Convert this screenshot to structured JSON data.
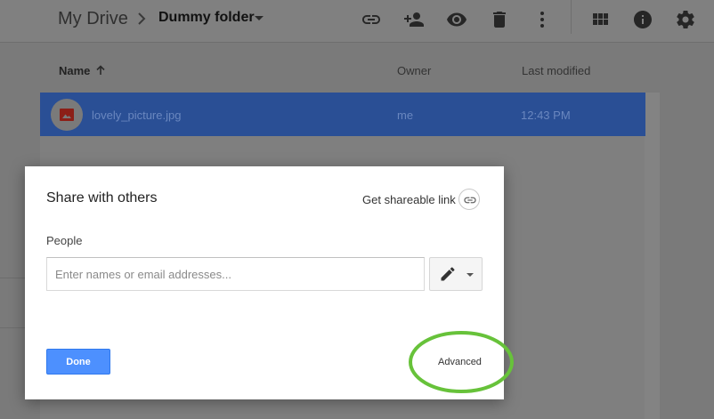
{
  "header": {
    "root_crumb": "My Drive",
    "folder_name": "Dummy folder",
    "toolbar_icons": [
      "link-icon",
      "add-person-icon",
      "preview-eye-icon",
      "trash-icon",
      "more-vert-icon",
      "grid-view-icon",
      "info-icon",
      "settings-gear-icon"
    ]
  },
  "file_list": {
    "columns": [
      "Name",
      "Owner",
      "Last modified"
    ],
    "sort_icon": "arrow-up-icon",
    "rows": [
      {
        "name": "lovely_picture.jpg",
        "owner": "me",
        "last_modified": "12:43 PM",
        "type_icon": "image-icon",
        "selected": true
      }
    ]
  },
  "share_dialog": {
    "title": "Share with others",
    "shareable_link_label": "Get shareable link",
    "people_label": "People",
    "people_input": {
      "value": "",
      "placeholder": "Enter names or email addresses..."
    },
    "permission_icon": "pencil-edit-icon",
    "done_label": "Done",
    "advanced_label": "Advanced"
  },
  "colors": {
    "selection_row": "#2a4f95",
    "done_button": "#4d90fe",
    "annotation_ring": "#67c23a",
    "overlay_backdrop": "#7a7a7a"
  }
}
